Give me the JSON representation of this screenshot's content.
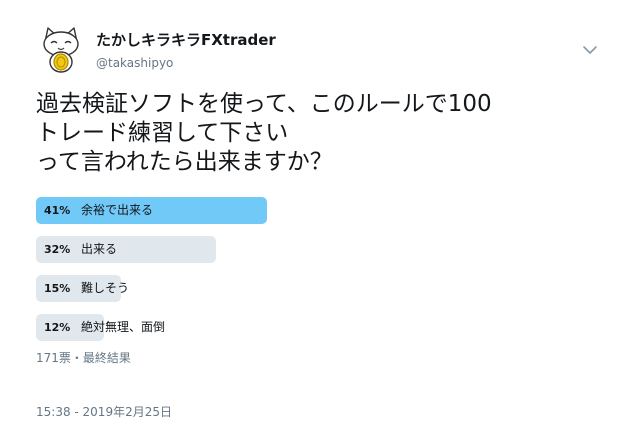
{
  "user": {
    "display_name": "たかしキラキラFXtrader",
    "handle": "@takashipyo",
    "avatar_icon": "cat-avatar-icon"
  },
  "tweet": {
    "text_lines": [
      "過去検証ソフトを使って、このルールで100",
      "トレード練習して下さい",
      "って言われたら出来ますか？"
    ]
  },
  "poll": {
    "choices": [
      {
        "percent_label": "41%",
        "percent": 41,
        "label": "余裕で出来る",
        "winner": true
      },
      {
        "percent_label": "32%",
        "percent": 32,
        "label": "出来る",
        "winner": false
      },
      {
        "percent_label": "15%",
        "percent": 15,
        "label": "難しそう",
        "winner": false
      },
      {
        "percent_label": "12%",
        "percent": 12,
        "label": "絶対無理、面倒",
        "winner": false
      }
    ],
    "meta": "171票・最終結果"
  },
  "timestamp": "15:38 - 2019年2月25日",
  "colors": {
    "winner_bar": "#71c9f8",
    "other_bar": "#e1e8ed",
    "secondary_text": "#657786",
    "primary_text": "#14171a"
  }
}
